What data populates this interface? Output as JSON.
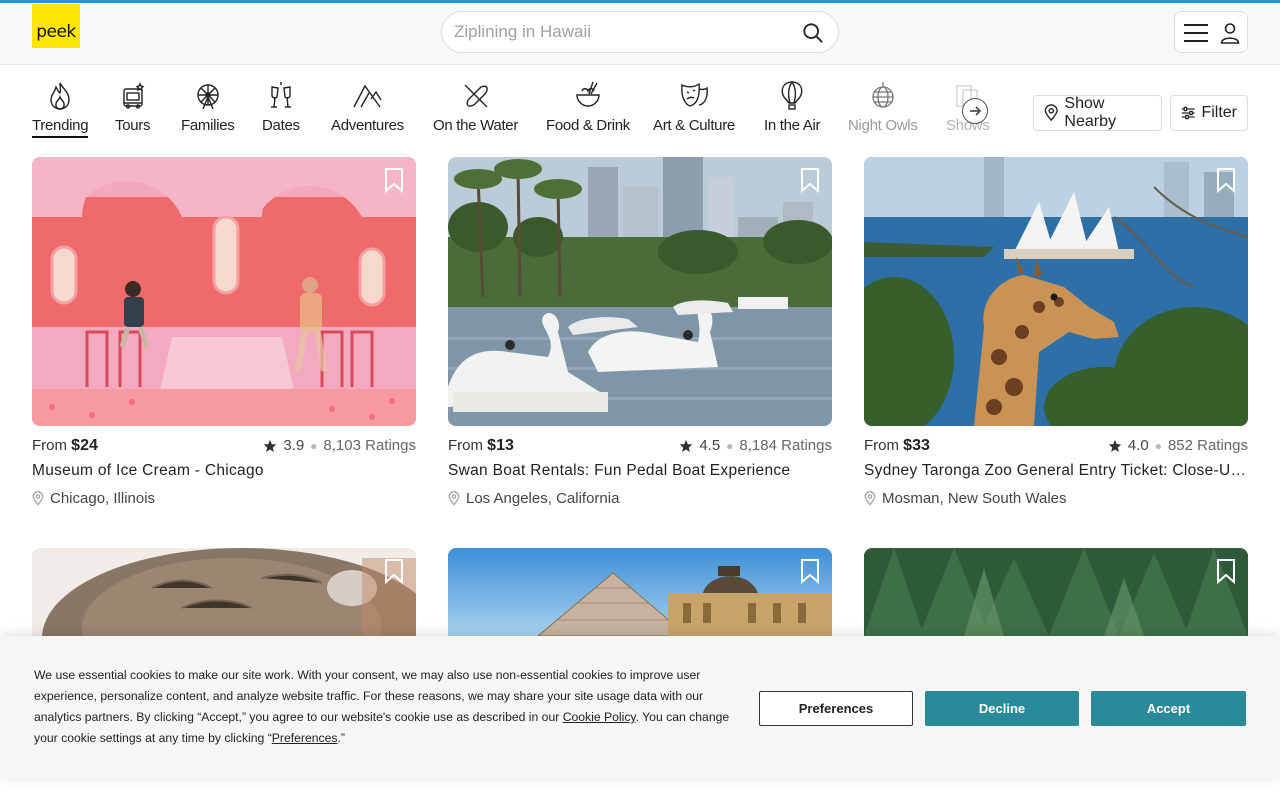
{
  "header": {
    "logo_text": "peek",
    "search_placeholder": "Ziplining in Hawaii"
  },
  "categories": [
    {
      "label": "Trending",
      "icon": "flame-icon",
      "active": true
    },
    {
      "label": "Tours",
      "icon": "bus-icon"
    },
    {
      "label": "Families",
      "icon": "ferris-wheel-icon"
    },
    {
      "label": "Dates",
      "icon": "champagne-glasses-icon"
    },
    {
      "label": "Adventures",
      "icon": "mountain-icon"
    },
    {
      "label": "On the Water",
      "icon": "paddle-icon"
    },
    {
      "label": "Food & Drink",
      "icon": "bowl-icon"
    },
    {
      "label": "Art & Culture",
      "icon": "theater-mask-icon"
    },
    {
      "label": "In the Air",
      "icon": "hot-air-balloon-icon"
    },
    {
      "label": "Night Owls",
      "icon": "disco-ball-icon"
    },
    {
      "label": "Shows",
      "icon": "ticket-icon"
    }
  ],
  "actions": {
    "show_nearby": "Show Nearby",
    "filter": "Filter"
  },
  "listings": [
    {
      "from": "From",
      "price": "$24",
      "rating": "3.9",
      "ratings_count": "8,103 Ratings",
      "title": "Museum of Ice Cream - Chicago",
      "location": "Chicago, Illinois"
    },
    {
      "from": "From",
      "price": "$13",
      "rating": "4.5",
      "ratings_count": "8,184 Ratings",
      "title": "Swan Boat Rentals: Fun Pedal Boat Experience",
      "location": "Los Angeles, California"
    },
    {
      "from": "From",
      "price": "$33",
      "rating": "4.0",
      "ratings_count": "852 Ratings",
      "title": "Sydney Taronga Zoo General Entry Ticket: Close-Up…",
      "location": "Mosman, New South Wales"
    }
  ],
  "cookie": {
    "text_1": "We use essential cookies to make our site work. With your consent, we may also use non-essential cookies to improve user experience, personalize content, and analyze website traffic. For these reasons, we may share your site usage data with our analytics partners. By clicking “Accept,” you agree to our website's cookie use as described in our ",
    "policy_link": "Cookie Policy",
    "text_2": ". You can change your cookie settings at any time by clicking “",
    "preferences_link": "Preferences",
    "text_3": ".”",
    "preferences_button": "Preferences",
    "decline_button": "Decline",
    "accept_button": "Accept"
  },
  "colors": {
    "brand_yellow": "#ffe600",
    "top_accent": "#2196d8",
    "cookie_button": "#2a8a9a"
  }
}
